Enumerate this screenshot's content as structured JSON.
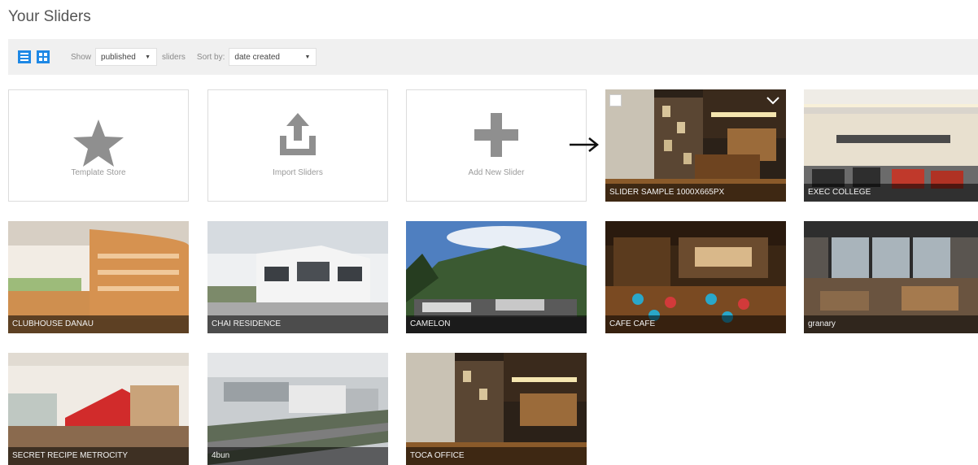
{
  "page": {
    "title": "Your Sliders"
  },
  "toolbar": {
    "view_list_icon": "list-view-icon",
    "view_grid_icon": "grid-view-icon",
    "show_label": "Show",
    "status_value": "published",
    "sliders_label": "sliders",
    "sort_label": "Sort by:",
    "sort_value": "date created"
  },
  "actions": [
    {
      "label": "Template Store",
      "icon": "star-icon"
    },
    {
      "label": "Import Sliders",
      "icon": "upload-icon"
    },
    {
      "label": "Add New Slider",
      "icon": "plus-icon"
    }
  ],
  "sliders": [
    {
      "title": "SLIDER SAMPLE 1000x665px"
    },
    {
      "title": "EXEC COLLEGE"
    },
    {
      "title": "CLUBHOUSE DANAU"
    },
    {
      "title": "CHAI RESIDENCE"
    },
    {
      "title": "CAMELON"
    },
    {
      "title": "CAFE CAFE"
    },
    {
      "title": "granary"
    },
    {
      "title": "SECRET RECIPE METROCITY"
    },
    {
      "title": "4bun"
    },
    {
      "title": "TOCA OFFICE"
    }
  ],
  "colors": {
    "accent": "#1e88e5",
    "icon_gray": "#9b9b9b"
  }
}
